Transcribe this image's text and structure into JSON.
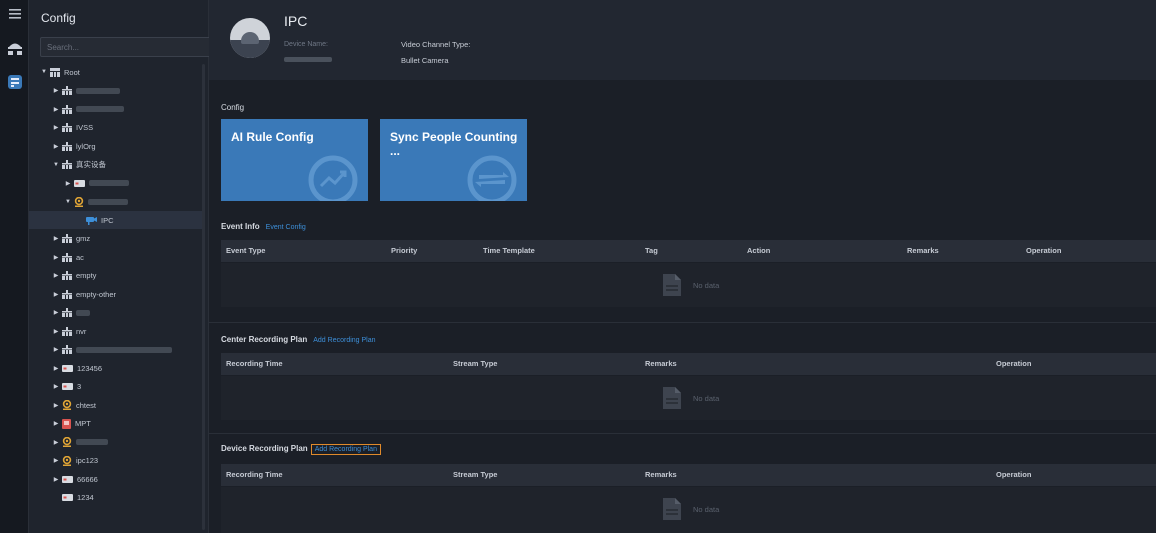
{
  "rail": {
    "icons": [
      "menu-icon",
      "device-tree-icon",
      "config-icon"
    ]
  },
  "tree_panel": {
    "title": "Config",
    "search_placeholder": "Search...",
    "nodes": [
      {
        "label": "Root",
        "level": 0,
        "expanded": true,
        "icon": "root-icon"
      },
      {
        "label": "",
        "level": 1,
        "icon": "org-icon"
      },
      {
        "label": "",
        "level": 1,
        "icon": "org-icon"
      },
      {
        "label": "IVSS",
        "level": 1,
        "icon": "org-icon"
      },
      {
        "label": "lylOrg",
        "level": 1,
        "icon": "org-icon"
      },
      {
        "label": "真实设备",
        "level": 1,
        "expanded": true,
        "icon": "org-icon"
      },
      {
        "label": "",
        "level": 2,
        "icon": "nvr-icon"
      },
      {
        "label": "",
        "level": 2,
        "expanded": true,
        "icon": "camera-device-icon"
      },
      {
        "label": "IPC",
        "level": 3,
        "selected": true,
        "icon": "ipc-channel-icon"
      },
      {
        "label": "gmz",
        "level": 1,
        "icon": "org-icon"
      },
      {
        "label": "ac",
        "level": 1,
        "icon": "org-icon"
      },
      {
        "label": "empty",
        "level": 1,
        "icon": "org-icon"
      },
      {
        "label": "empty-other",
        "level": 1,
        "icon": "org-icon"
      },
      {
        "label": "",
        "level": 1,
        "icon": "org-icon"
      },
      {
        "label": "nvr",
        "level": 1,
        "icon": "org-icon"
      },
      {
        "label": "",
        "level": 1,
        "icon": "org-icon"
      },
      {
        "label": "123456",
        "level": 1,
        "icon": "nvr-icon"
      },
      {
        "label": "3",
        "level": 1,
        "icon": "nvr-icon"
      },
      {
        "label": "chtest",
        "level": 1,
        "icon": "camera-device-icon"
      },
      {
        "label": "MPT",
        "level": 1,
        "icon": "mpt-icon"
      },
      {
        "label": "",
        "level": 1,
        "icon": "camera-device-icon"
      },
      {
        "label": "ipc123",
        "level": 1,
        "icon": "camera-device-icon"
      },
      {
        "label": "66666",
        "level": 1,
        "icon": "nvr-icon"
      },
      {
        "label": "1234",
        "level": 1,
        "icon": "nvr-icon",
        "no_arrow": true
      }
    ]
  },
  "device": {
    "name": "IPC",
    "device_name_label": "Device Name:",
    "video_channel_type_label": "Video Channel Type:",
    "video_channel_type_value": "Bullet Camera"
  },
  "config": {
    "section_title": "Config",
    "cards": [
      {
        "title": "AI Rule Config",
        "icon": "chart-trend-icon"
      },
      {
        "title": "Sync People Counting ...",
        "icon": "sync-arrows-icon"
      }
    ]
  },
  "event_info": {
    "title": "Event Info",
    "link": "Event Config",
    "columns": [
      "Event Type",
      "Priority",
      "Time Template",
      "Tag",
      "Action",
      "Remarks",
      "Operation"
    ],
    "empty_text": "No data"
  },
  "center_recording": {
    "title": "Center Recording Plan",
    "link": "Add Recording Plan",
    "columns": [
      "Recording Time",
      "Stream Type",
      "Remarks",
      "Operation"
    ],
    "empty_text": "No data"
  },
  "device_recording": {
    "title": "Device Recording Plan",
    "link": "Add Recording Plan",
    "columns": [
      "Recording Time",
      "Stream Type",
      "Remarks",
      "Operation"
    ],
    "empty_text": "No data"
  },
  "colors": {
    "accent": "#3d8fd9",
    "card": "#3a79b8",
    "highlight": "#e08a2b"
  }
}
